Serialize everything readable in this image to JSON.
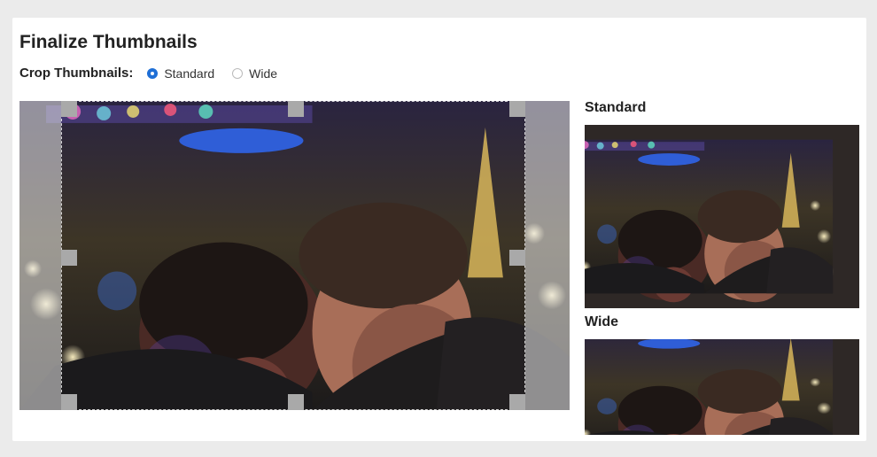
{
  "page": {
    "title": "Finalize Thumbnails"
  },
  "crop": {
    "label": "Crop Thumbnails:",
    "options": [
      {
        "label": "Standard",
        "selected": true
      },
      {
        "label": "Wide",
        "selected": false
      }
    ]
  },
  "previews": {
    "standard_label": "Standard",
    "wide_label": "Wide"
  },
  "colors": {
    "accent": "#1f6fd6",
    "panel_bg": "#ffffff",
    "page_bg": "#ebebeb",
    "handle": "#a9a9a9"
  }
}
